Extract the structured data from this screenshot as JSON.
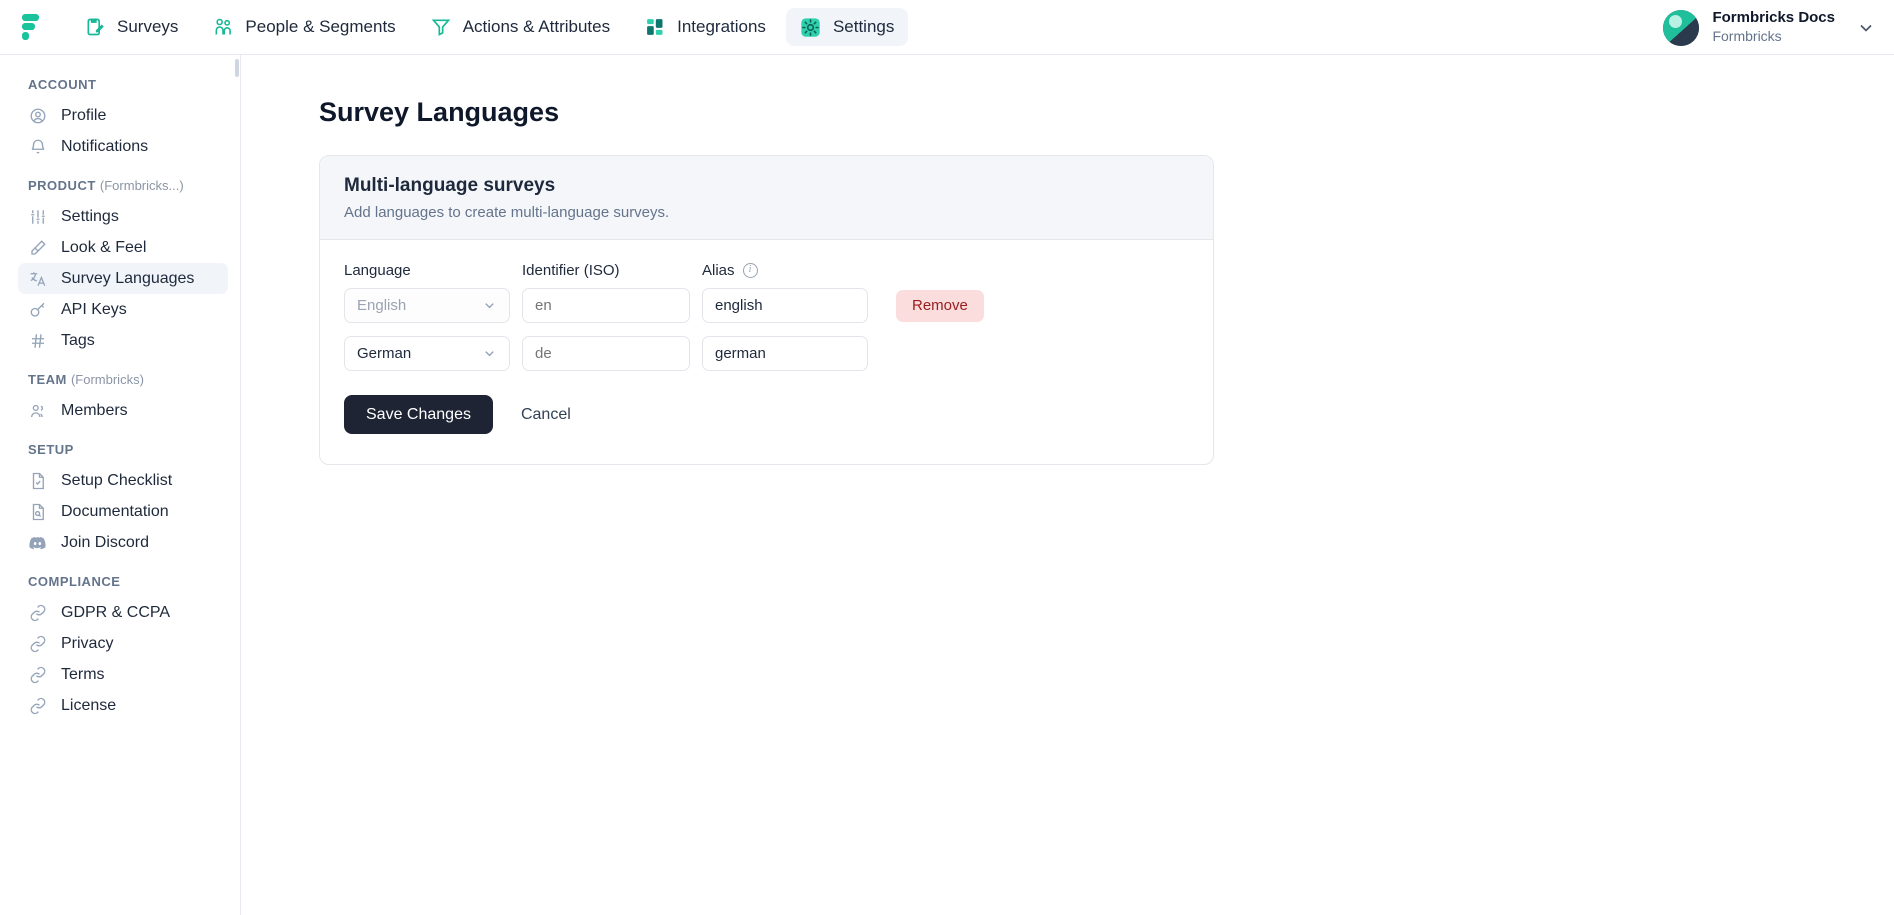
{
  "topnav": {
    "logo_icon": "formbricks-logo-icon",
    "items": [
      {
        "label": "Surveys",
        "icon": "clipboard-pencil-icon",
        "active": false
      },
      {
        "label": "People & Segments",
        "icon": "people-icon",
        "active": false
      },
      {
        "label": "Actions & Attributes",
        "icon": "funnel-icon",
        "active": false
      },
      {
        "label": "Integrations",
        "icon": "blocks-icon",
        "active": false
      },
      {
        "label": "Settings",
        "icon": "gear-icon",
        "active": true
      }
    ],
    "account": {
      "name": "Formbricks Docs",
      "org": "Formbricks",
      "avatar_icon": "avatar-image",
      "chevron_icon": "chevron-down-icon"
    }
  },
  "sidebar": {
    "groups": [
      {
        "heading": "ACCOUNT",
        "heading_sub": "",
        "items": [
          {
            "label": "Profile",
            "icon": "user-circle-icon",
            "active": false
          },
          {
            "label": "Notifications",
            "icon": "bell-icon",
            "active": false
          }
        ]
      },
      {
        "heading": "PRODUCT",
        "heading_sub": "(Formbricks...)",
        "items": [
          {
            "label": "Settings",
            "icon": "sliders-icon",
            "active": false
          },
          {
            "label": "Look & Feel",
            "icon": "brush-icon",
            "active": false
          },
          {
            "label": "Survey Languages",
            "icon": "languages-icon",
            "active": true
          },
          {
            "label": "API Keys",
            "icon": "key-icon",
            "active": false
          },
          {
            "label": "Tags",
            "icon": "hash-icon",
            "active": false
          }
        ]
      },
      {
        "heading": "TEAM",
        "heading_sub": "(Formbricks)",
        "items": [
          {
            "label": "Members",
            "icon": "users-icon",
            "active": false
          }
        ]
      },
      {
        "heading": "SETUP",
        "heading_sub": "",
        "items": [
          {
            "label": "Setup Checklist",
            "icon": "file-check-icon",
            "active": false
          },
          {
            "label": "Documentation",
            "icon": "file-search-icon",
            "active": false
          },
          {
            "label": "Join Discord",
            "icon": "discord-icon",
            "active": false
          }
        ]
      },
      {
        "heading": "COMPLIANCE",
        "heading_sub": "",
        "items": [
          {
            "label": "GDPR & CCPA",
            "icon": "link-icon",
            "active": false
          },
          {
            "label": "Privacy",
            "icon": "link-icon",
            "active": false
          },
          {
            "label": "Terms",
            "icon": "link-icon",
            "active": false
          },
          {
            "label": "License",
            "icon": "link-icon",
            "active": false
          }
        ]
      }
    ]
  },
  "main": {
    "page_title": "Survey Languages",
    "card": {
      "title": "Multi-language surveys",
      "subtitle": "Add languages to create multi-language surveys.",
      "columns": {
        "language": "Language",
        "identifier": "Identifier (ISO)",
        "alias": "Alias",
        "alias_info_icon": "info-icon"
      },
      "rows": [
        {
          "language_value": "English",
          "language_is_placeholder": true,
          "iso_value": "",
          "iso_placeholder": "en",
          "alias_value": "english",
          "alias_placeholder": "",
          "remove_label": "Remove",
          "has_remove": true
        },
        {
          "language_value": "German",
          "language_is_placeholder": false,
          "iso_value": "",
          "iso_placeholder": "de",
          "alias_value": "german",
          "alias_placeholder": "",
          "remove_label": "",
          "has_remove": false
        }
      ],
      "save_label": "Save Changes",
      "cancel_label": "Cancel"
    }
  },
  "colors": {
    "brand_teal": "#1fbf9c",
    "dark": "#1e2434",
    "remove_bg": "#fbdddd",
    "remove_fg": "#9b1c1c",
    "card_head_bg": "#f4f6fa"
  }
}
